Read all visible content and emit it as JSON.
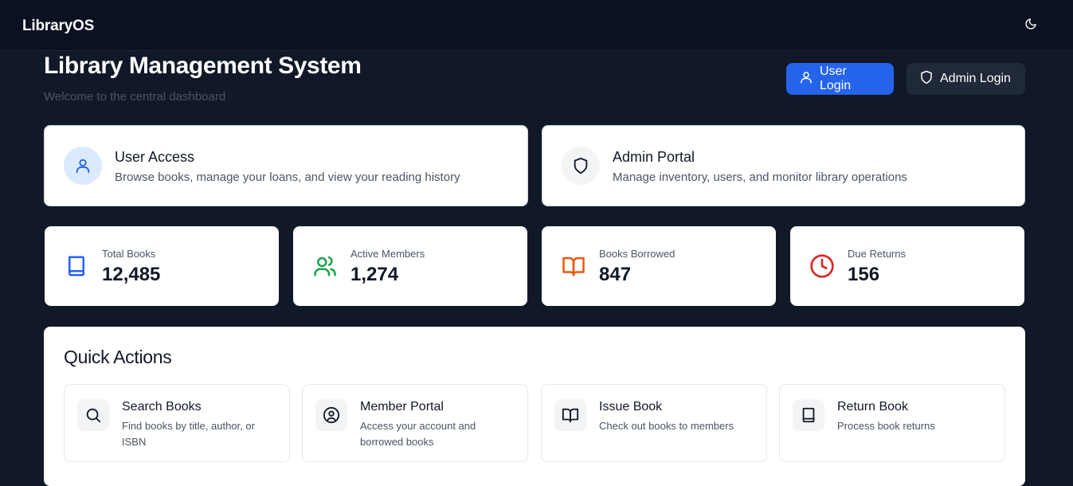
{
  "header": {
    "brand": "LibraryOS",
    "theme_icon": "moon-icon"
  },
  "page": {
    "title": "Library Management System",
    "subtitle": "Welcome to the central dashboard",
    "user_login_label": "User Login",
    "admin_login_label": "Admin Login"
  },
  "portals": [
    {
      "title": "User Access",
      "description": "Browse books, manage your loans, and view your reading history",
      "icon": "user-icon"
    },
    {
      "title": "Admin Portal",
      "description": "Manage inventory, users, and monitor library operations",
      "icon": "shield-icon"
    }
  ],
  "stats": [
    {
      "label": "Total Books",
      "value": "12,485",
      "icon": "book-icon",
      "color": "#2563eb"
    },
    {
      "label": "Active Members",
      "value": "1,274",
      "icon": "users-icon",
      "color": "#16a34a"
    },
    {
      "label": "Books Borrowed",
      "value": "847",
      "icon": "book-open-icon",
      "color": "#ea580c"
    },
    {
      "label": "Due Returns",
      "value": "156",
      "icon": "clock-icon",
      "color": "#dc2626"
    }
  ],
  "quick_actions": {
    "title": "Quick Actions",
    "items": [
      {
        "name": "Search Books",
        "description": "Find books by title, author, or ISBN",
        "icon": "search-icon"
      },
      {
        "name": "Member Portal",
        "description": "Access your account and borrowed books",
        "icon": "user-circle-icon"
      },
      {
        "name": "Issue Book",
        "description": "Check out books to members",
        "icon": "book-open-icon"
      },
      {
        "name": "Return Book",
        "description": "Process book returns",
        "icon": "book-icon"
      }
    ]
  },
  "colors": {
    "background": "#111827",
    "topbar": "#0b1120",
    "primary": "#2563eb",
    "card": "#ffffff"
  }
}
